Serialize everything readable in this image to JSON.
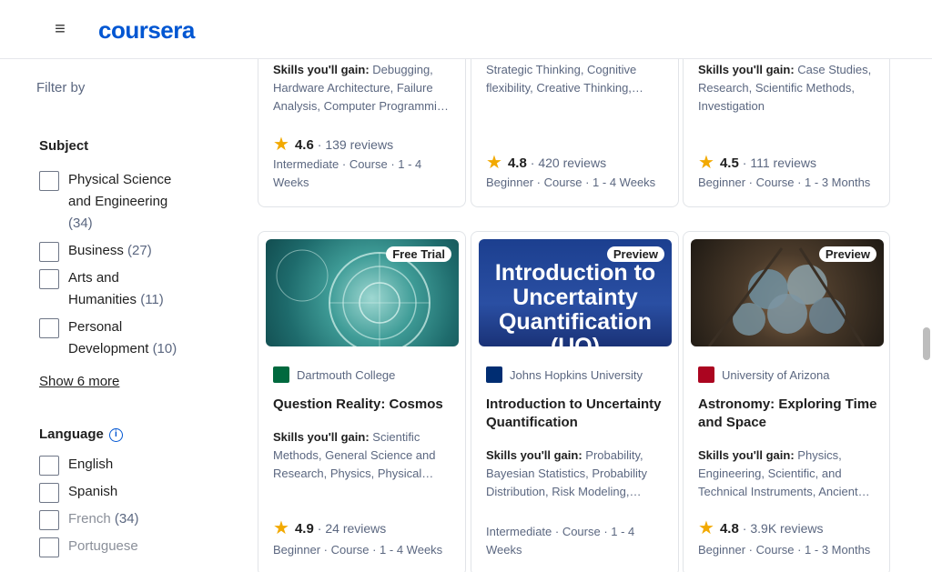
{
  "header": {
    "logo": "coursera",
    "menu_icon": "menu-icon"
  },
  "sidebar": {
    "filter_by": "Filter by",
    "subject": {
      "title": "Subject",
      "options": [
        {
          "label": "Physical Science and Engineering",
          "count": "(34)"
        },
        {
          "label": "Business",
          "count": "(27)"
        },
        {
          "label": "Arts and Humanities",
          "count": "(11)"
        },
        {
          "label": "Personal Development",
          "count": "(10)"
        }
      ],
      "show_more": "Show 6 more"
    },
    "language": {
      "title": "Language",
      "options": [
        {
          "label": "English",
          "count": ""
        },
        {
          "label": "Spanish",
          "count": ""
        },
        {
          "label": "French",
          "count": "(34)"
        },
        {
          "label": "Portuguese",
          "count": ""
        }
      ]
    }
  },
  "cards_top": [
    {
      "skills_label": "Skills you'll gain:",
      "skills": "Debugging, Hardware Architecture, Failure Analysis, Computer Programmi…",
      "rating": "4.6",
      "reviews": "139 reviews",
      "meta": "Intermediate · Course · 1 - 4 Weeks"
    },
    {
      "skills_label": "",
      "skills": "Strategic Thinking, Cognitive flexibility, Creative Thinking,…",
      "rating": "4.8",
      "reviews": "420 reviews",
      "meta": "Beginner · Course · 1 - 4 Weeks"
    },
    {
      "skills_label": "Skills you'll gain:",
      "skills": "Case Studies, Research, Scientific Methods, Investigation",
      "rating": "4.5",
      "reviews": "111 reviews",
      "meta": "Beginner · Course · 1 - 3 Months"
    }
  ],
  "cards_bottom": [
    {
      "badge": "Free Trial",
      "partner": "Dartmouth College",
      "title": "Question Reality: Cosmos",
      "skills_label": "Skills you'll gain:",
      "skills": "Scientific Methods, General Science and Research, Physics, Physical…",
      "rating": "4.9",
      "reviews": "24 reviews",
      "meta": "Beginner · Course · 1 - 4 Weeks",
      "partner_color": "#00693e"
    },
    {
      "badge": "Preview",
      "thumb_text": "Introduction to Uncertainty Quantification (UQ)",
      "partner": "Johns Hopkins University",
      "title": "Introduction to Uncertainty Quantification",
      "skills_label": "Skills you'll gain:",
      "skills": "Probability, Bayesian Statistics, Probability Distribution, Risk Modeling,…",
      "rating": "",
      "reviews": "",
      "meta": "Intermediate · Course · 1 - 4 Weeks",
      "partner_color": "#002d72"
    },
    {
      "badge": "Preview",
      "partner": "University of Arizona",
      "title": "Astronomy: Exploring Time and Space",
      "skills_label": "Skills you'll gain:",
      "skills": "Physics, Engineering, Scientific, and Technical Instruments, Ancient…",
      "rating": "4.8",
      "reviews": "3.9K reviews",
      "meta": "Beginner · Course · 1 - 3 Months",
      "partner_color": "#ab0520"
    }
  ],
  "colors": {
    "brand": "#0056d2",
    "star": "#f2a900"
  }
}
